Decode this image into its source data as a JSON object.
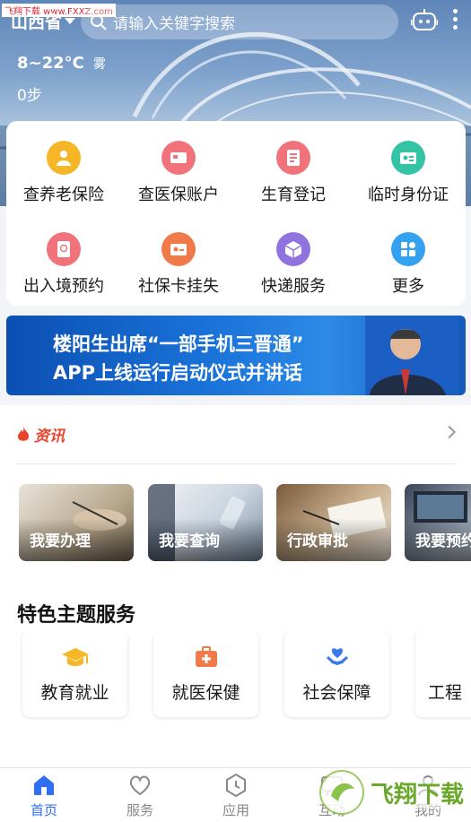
{
  "watermark": "飞翔下载 www.FXXZ.com",
  "header": {
    "province": "山西省",
    "search_placeholder": "请输入关键字搜索"
  },
  "weather": {
    "temperature": "8~22°C",
    "condition": "雾",
    "steps": "0步"
  },
  "services": [
    {
      "label": "查养老保险",
      "icon": "pension-icon",
      "color": "#f5b728"
    },
    {
      "label": "查医保账户",
      "icon": "medical-card-icon",
      "color": "#f0727a"
    },
    {
      "label": "生育登记",
      "icon": "document-icon",
      "color": "#f0727a"
    },
    {
      "label": "临时身份证",
      "icon": "id-card-icon",
      "color": "#35c3a6"
    },
    {
      "label": "出入境预约",
      "icon": "passport-icon",
      "color": "#f0727a"
    },
    {
      "label": "社保卡挂失",
      "icon": "social-card-icon",
      "color": "#f07a4a"
    },
    {
      "label": "快递服务",
      "icon": "package-icon",
      "color": "#8f74e0"
    },
    {
      "label": "更多",
      "icon": "grid-icon",
      "color": "#35a2f0"
    }
  ],
  "banner": {
    "line1": "楼阳生出席“一部手机三晋通”",
    "line2": "APP上线运行启动仪式并讲话"
  },
  "news": {
    "title": "资讯",
    "tiles": [
      {
        "label": "我要办理"
      },
      {
        "label": "我要查询"
      },
      {
        "label": "行政审批"
      },
      {
        "label": "我要预约"
      }
    ]
  },
  "featured": {
    "title": "特色主题服务",
    "items": [
      {
        "label": "教育就业",
        "icon": "graduation-cap-icon",
        "color": "#f5b728"
      },
      {
        "label": "就医保健",
        "icon": "medical-kit-icon",
        "color": "#f07a4a"
      },
      {
        "label": "社会保障",
        "icon": "heart-hands-icon",
        "color": "#3a7be8"
      },
      {
        "label": "工程",
        "icon": "",
        "color": ""
      }
    ]
  },
  "tabbar": [
    {
      "label": "首页",
      "icon": "home-icon",
      "active": true
    },
    {
      "label": "服务",
      "icon": "heart-icon",
      "active": false
    },
    {
      "label": "应用",
      "icon": "clock-hex-icon",
      "active": false
    },
    {
      "label": "互动",
      "icon": "chat-icon",
      "active": false
    },
    {
      "label": "我的",
      "icon": "user-icon",
      "active": false
    }
  ],
  "colors": {
    "accent": "#2f6ff2",
    "news_red": "#e8452c"
  },
  "brand_logo": "飞翔下载"
}
